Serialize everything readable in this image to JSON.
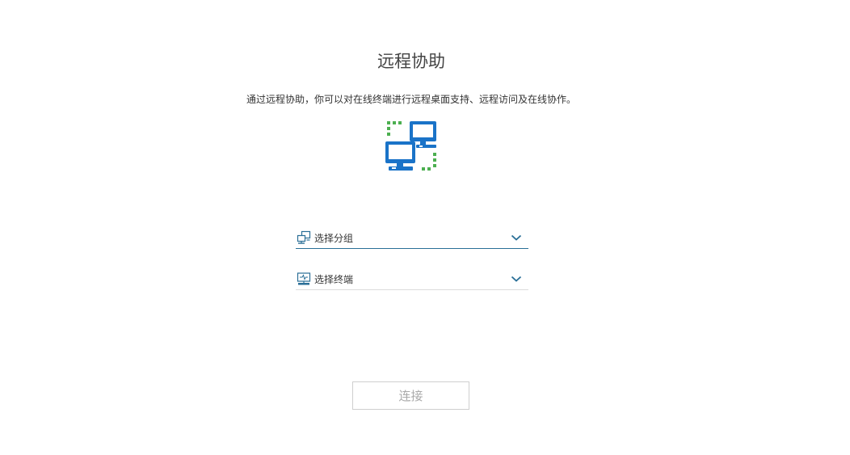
{
  "page": {
    "title": "远程协助",
    "description": "通过远程协助，你可以对在线终端进行远程桌面支持、远程访问及在线协作。"
  },
  "hero": {
    "icon": "remote-computers-icon",
    "colors": {
      "monitor": "#1a73c8",
      "dots": "#4caf50"
    }
  },
  "form": {
    "group_select": {
      "placeholder": "选择分组",
      "icon": "group-network-icon"
    },
    "terminal_select": {
      "placeholder": "选择终端",
      "icon": "terminal-monitor-icon"
    }
  },
  "actions": {
    "connect_label": "连接",
    "connect_disabled": true
  },
  "colors": {
    "accent": "#2a6f97",
    "icon": "#2a6f97"
  }
}
